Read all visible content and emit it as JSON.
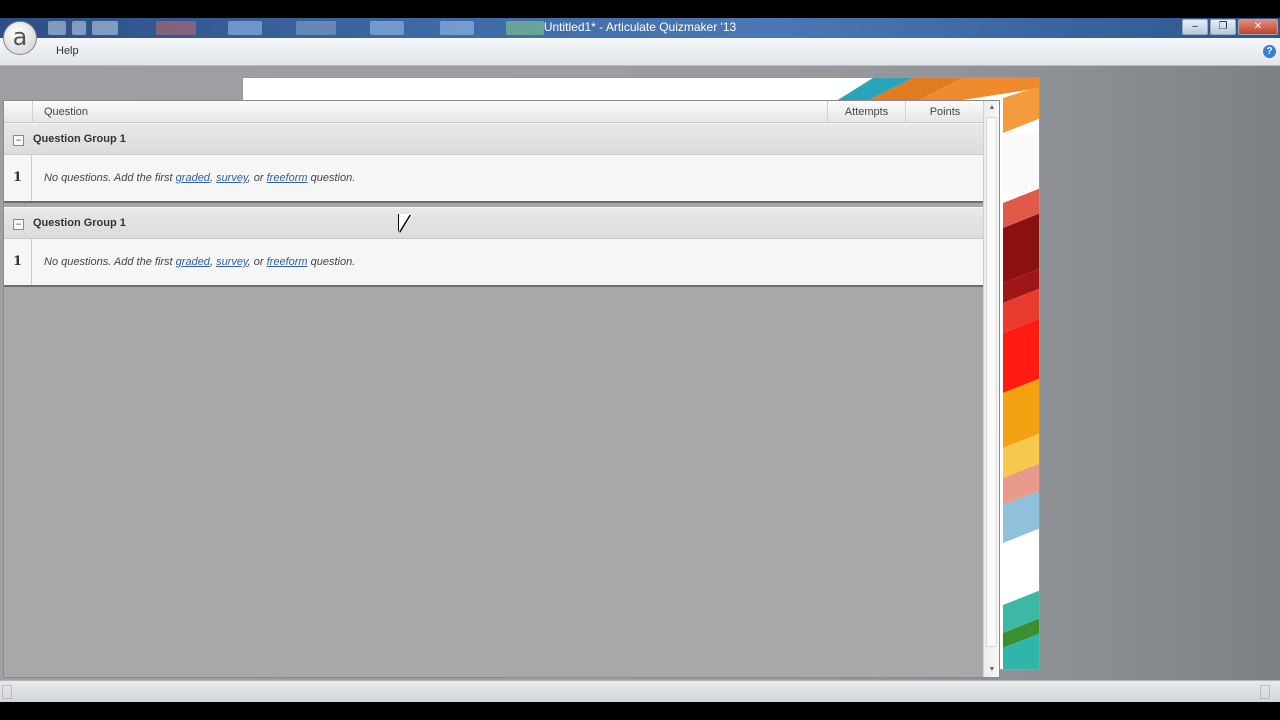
{
  "window": {
    "title": "Untitled1* -  Articulate Quizmaker '13",
    "minimize": "–",
    "maximize": "❐",
    "close": "✕"
  },
  "app_logo": "a",
  "menu": {
    "help": "Help",
    "help_icon": "?"
  },
  "columns": {
    "question": "Question",
    "attempts": "Attempts",
    "points": "Points"
  },
  "groups": [
    {
      "toggle": "−",
      "name": "Question Group 1",
      "row_number": "1",
      "text_prefix": "No questions. Add the first ",
      "link_graded": "graded",
      "sep1": ", ",
      "link_survey": "survey",
      "sep2": ", or ",
      "link_freeform": "freeform",
      "text_suffix": " question."
    },
    {
      "toggle": "−",
      "name": "Question Group 1",
      "row_number": "1",
      "text_prefix": "No questions. Add the first ",
      "link_graded": "graded",
      "sep1": ", ",
      "link_survey": "survey",
      "sep2": ", or ",
      "link_freeform": "freeform",
      "text_suffix": " question."
    }
  ],
  "scroll": {
    "up": "▲",
    "down": "▼"
  },
  "colors": {
    "titlebar": "#3f6aa5",
    "link": "#2f5fa8",
    "panel_bg": "#a8a8a8",
    "slide_stripes": [
      "#2aa4b8",
      "#e07b1f",
      "#ef8a2e",
      "#c0392b",
      "#8b1111",
      "#a01616",
      "#e63b2e",
      "#ff1a12",
      "#f2a111",
      "#e9a21a",
      "#f6c84c",
      "#e99a8a",
      "#8fc1dc",
      "#ffffff",
      "#3db8a6",
      "#3a8f2f",
      "#2fb6aa"
    ]
  }
}
